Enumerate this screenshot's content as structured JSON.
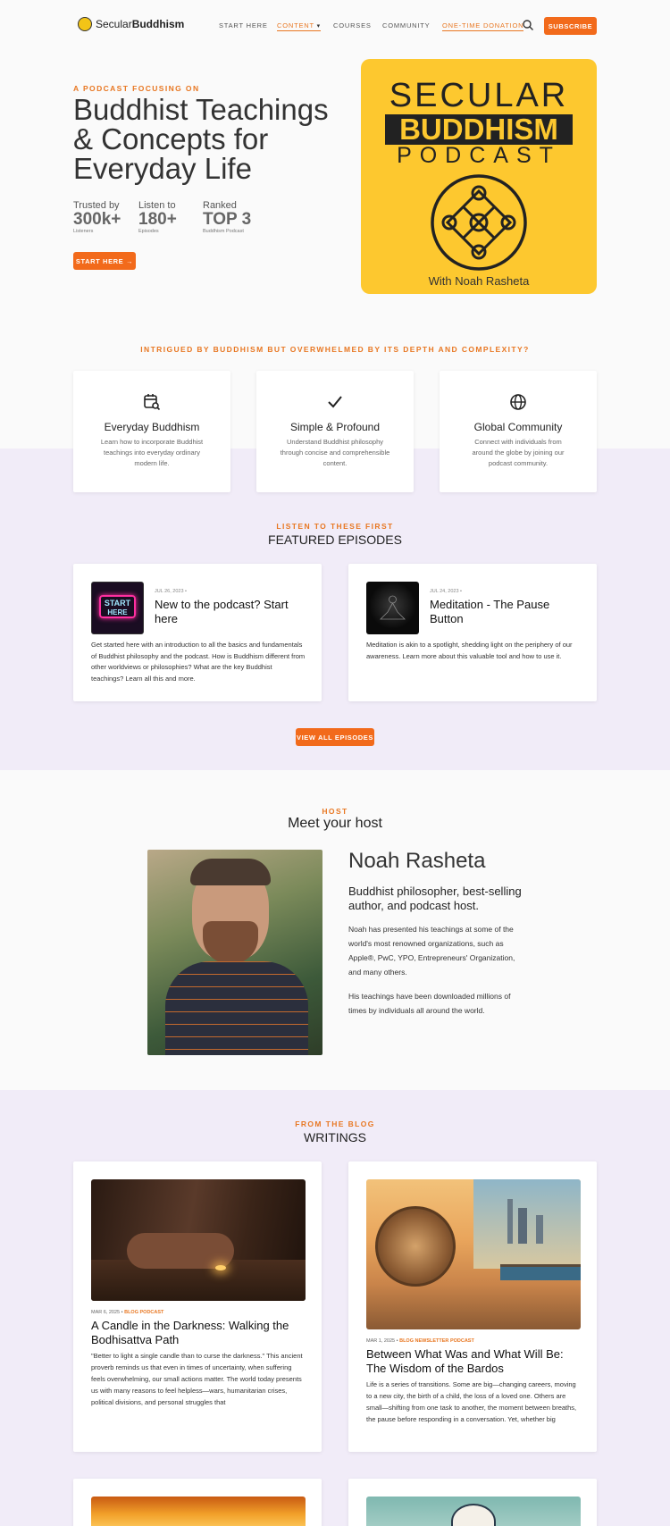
{
  "header": {
    "logo_light": "Secular",
    "logo_bold": "Buddhism",
    "nav": [
      "START HERE",
      "CONTENT",
      "COURSES",
      "COMMUNITY",
      "ONE-TIME DONATION"
    ],
    "subscribe": "SUBSCRIBE"
  },
  "hero": {
    "eyebrow": "A PODCAST FOCUSING ON",
    "title": "Buddhist Teachings & Concepts for Everyday Life",
    "stats": [
      {
        "label": "Trusted by",
        "value": "300k+",
        "sub": "Listeners"
      },
      {
        "label": "Listen to",
        "value": "180+",
        "sub": "Episodes"
      },
      {
        "label": "Ranked",
        "value": "TOP 3",
        "sub": "Buddhism Podcast"
      }
    ],
    "cta": "START HERE →",
    "art": {
      "line1": "SECULAR",
      "line2": "BUDDHISM",
      "line3": "PODCAST",
      "byline": "With Noah Rasheta"
    }
  },
  "intro": {
    "eyebrow": "INTRIGUED BY BUDDHISM BUT OVERWHELMED BY ITS DEPTH AND COMPLEXITY?",
    "features": [
      {
        "title": "Everyday Buddhism",
        "desc": "Learn how to incorporate Buddhist teachings into everyday ordinary modern life."
      },
      {
        "title": "Simple & Profound",
        "desc": "Understand Buddhist philosophy through concise and comprehensible content."
      },
      {
        "title": "Global Community",
        "desc": "Connect with individuals from around the globe by joining our podcast community."
      }
    ]
  },
  "episodes": {
    "eyebrow": "LISTEN TO THESE FIRST",
    "title": "FEATURED EPISODES",
    "items": [
      {
        "date": "JUL 26, 2023 •",
        "title": "New to the podcast? Start here",
        "thumb_text1": "START",
        "thumb_text2": "HERE",
        "desc": "Get started here with an introduction to all the basics and fundamentals of Buddhist philosophy and the podcast. How is Buddhism different from other worldviews or philosophies? What are the key Buddhist teachings? Learn all this and more."
      },
      {
        "date": "JUL 24, 2023 •",
        "title": "Meditation - The Pause Button",
        "desc": "Meditation is akin to a spotlight, shedding light on the periphery of our awareness. Learn more about this valuable tool and how to use it."
      }
    ],
    "view_all": "VIEW ALL EPISODES"
  },
  "host": {
    "eyebrow": "HOST",
    "title": "Meet your host",
    "name": "Noah Rasheta",
    "tagline": "Buddhist philosopher, best-selling author, and podcast host.",
    "bio1": "Noah has presented his teachings at some of the world's most renowned organizations, such as Apple®, PwC, YPO, Entrepreneurs' Organization, and many others.",
    "bio2": "His teachings have been downloaded millions of times by individuals all around the world."
  },
  "blog": {
    "eyebrow": "FROM THE BLOG",
    "title": "WRITINGS",
    "posts": [
      {
        "date": "MAR 6, 2025 •",
        "tags": [
          "BLOG",
          "PODCAST"
        ],
        "title": "A Candle in the Darkness: Walking the Bodhisattva Path",
        "excerpt": "\"Better to light a single candle than to curse the darkness.\" This ancient proverb reminds us that even in times of uncertainty, when suffering feels overwhelming, our small actions matter. The world today presents us with many reasons to feel helpless—wars, humanitarian crises, political divisions, and personal struggles that"
      },
      {
        "date": "MAR 1, 2025 •",
        "tags": [
          "BLOG",
          "NEWSLETTER",
          "PODCAST"
        ],
        "title": "Between What Was and What Will Be: The Wisdom of the Bardos",
        "excerpt": "Life is a series of transitions. Some are big—changing careers, moving to a new city, the birth of a child, the loss of a loved one. Others are small—shifting from one task to another, the moment between breaths, the pause before responding in a conversation. Yet, whether big"
      }
    ]
  },
  "colors": {
    "accent": "#f26a1b",
    "eyebrow": "#e87722",
    "art_yellow": "#fdc82f",
    "lavender": "#f1ecf8"
  }
}
